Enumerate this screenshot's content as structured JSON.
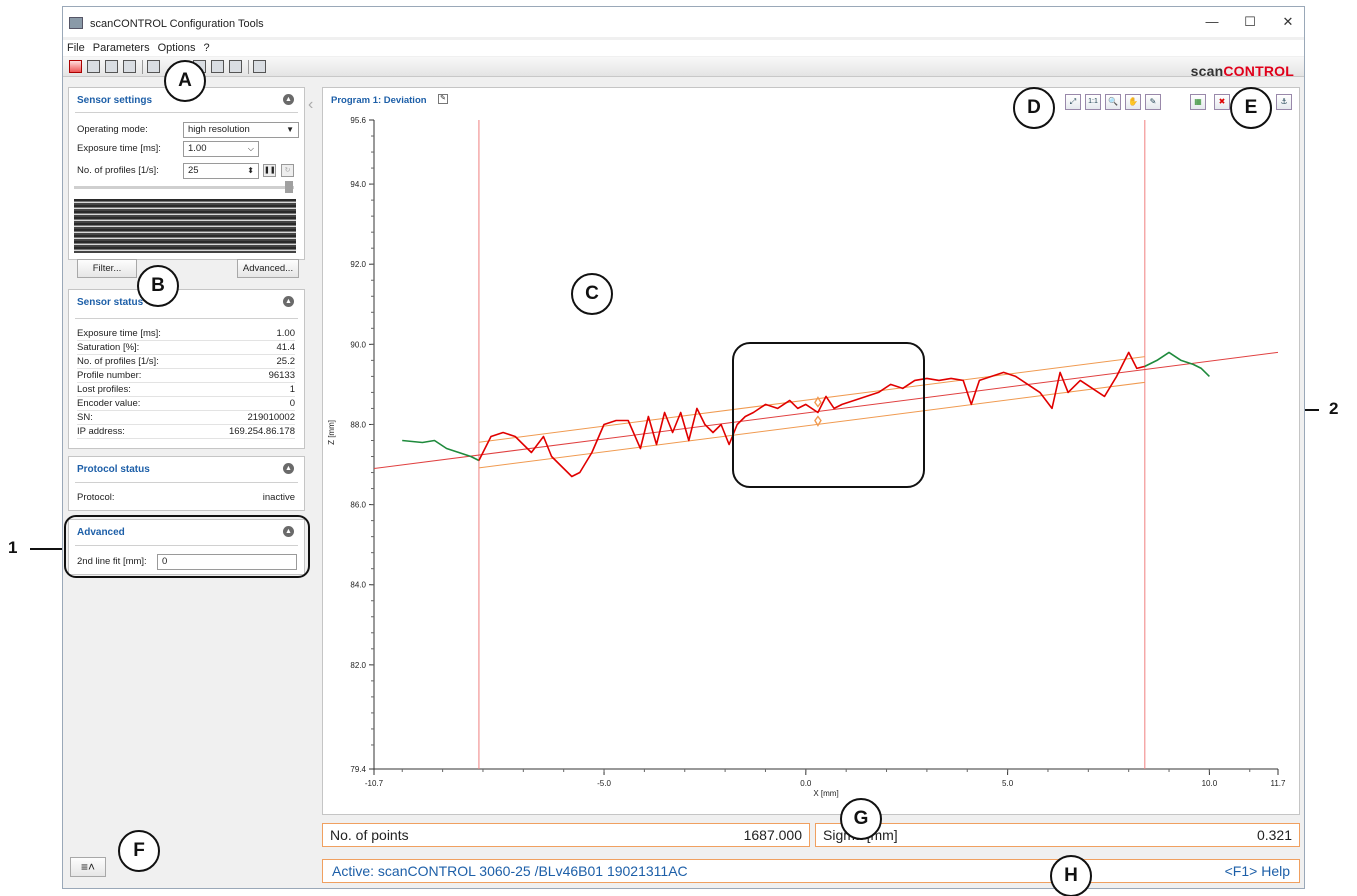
{
  "window": {
    "title": "scanCONTROL Configuration Tools",
    "controls": {
      "minimize": "—",
      "maximize": "☐",
      "close": "✕"
    }
  },
  "menu": [
    "File",
    "Parameters",
    "Options",
    "?"
  ],
  "brand": {
    "part1": "scan",
    "part2": "CONTROL",
    "accent": "#e0001a"
  },
  "sensor_settings": {
    "title": "Sensor settings",
    "operating_mode_label": "Operating mode:",
    "operating_mode_value": "high resolution",
    "exposure_label": "Exposure time [ms]:",
    "exposure_value": "1.00",
    "profiles_label": "No. of profiles [1/s]:",
    "profiles_value": "25",
    "filter_button": "Filter...",
    "advanced_button": "Advanced..."
  },
  "sensor_status": {
    "title": "Sensor status",
    "rows": [
      {
        "k": "Exposure time [ms]:",
        "v": "1.00"
      },
      {
        "k": "Saturation [%]:",
        "v": "41.4"
      },
      {
        "k": "No. of profiles [1/s]:",
        "v": "25.2"
      },
      {
        "k": "Profile number:",
        "v": "96133"
      },
      {
        "k": "Lost profiles:",
        "v": "1"
      },
      {
        "k": "Encoder value:",
        "v": "0"
      },
      {
        "k": "SN:",
        "v": "219010002"
      },
      {
        "k": "IP address:",
        "v": "169.254.86.178"
      }
    ]
  },
  "protocol_status": {
    "title": "Protocol status",
    "protocol_label": "Protocol:",
    "protocol_value": "inactive"
  },
  "advanced": {
    "title": "Advanced",
    "line_fit_label": "2nd line fit [mm]:",
    "line_fit_value": "0"
  },
  "graph": {
    "title": "Program 1: Deviation",
    "toolbar_icons": [
      "fit-icon",
      "one-to-one-icon",
      "zoom-icon",
      "pan-icon",
      "eyedropper-icon",
      "grid-icon",
      "remove-icon",
      "anchor-icon"
    ],
    "toolbar_glyphs": [
      "⤢",
      "1:1",
      "🔍",
      "✋",
      "✎",
      "▦",
      "✖",
      "⚓"
    ]
  },
  "chart_data": {
    "type": "line",
    "title": "Program 1: Deviation",
    "xlabel": "X [mm]",
    "ylabel": "Z [mm]",
    "xlim": [
      -10.7,
      11.7
    ],
    "ylim": [
      79.4,
      95.6
    ],
    "xticks": [
      "-10.7",
      "-5.0",
      "0.0",
      "5.0",
      "10.0",
      "11.7"
    ],
    "xtick_values": [
      -10.7,
      -5.0,
      0.0,
      5.0,
      10.0,
      11.7
    ],
    "yticks": [
      "95.6",
      "94.0",
      "92.0",
      "90.0",
      "88.0",
      "86.0",
      "84.0",
      "82.0",
      "79.4"
    ],
    "ytick_values": [
      95.6,
      94.0,
      92.0,
      90.0,
      88.0,
      86.0,
      84.0,
      82.0,
      79.4
    ],
    "vertical_lines": [
      -8.1,
      8.4
    ],
    "fit_line": {
      "x": [
        -10.7,
        11.7
      ],
      "y": [
        86.9,
        89.8
      ]
    },
    "tolerance_offset": 0.321,
    "series": [
      {
        "color": "#1e8a3c",
        "x": [
          -10.0,
          -9.5,
          -9.2,
          -8.9,
          -8.6,
          -8.3,
          -8.1
        ],
        "y": [
          87.6,
          87.55,
          87.6,
          87.4,
          87.3,
          87.2,
          87.1
        ]
      },
      {
        "color": "#e00000",
        "x": [
          -8.1,
          -7.8,
          -7.5,
          -7.2,
          -7.0,
          -6.8,
          -6.5,
          -6.3,
          -6.0,
          -5.8,
          -5.6,
          -5.3,
          -5.0,
          -4.7,
          -4.4,
          -4.1,
          -3.9,
          -3.7,
          -3.5,
          -3.3,
          -3.1,
          -2.9,
          -2.7,
          -2.5,
          -2.3,
          -2.1,
          -1.9,
          -1.7,
          -1.5,
          -1.3,
          -1.0,
          -0.7,
          -0.4,
          -0.2,
          0.0,
          0.3,
          0.5,
          0.7,
          0.9,
          1.2,
          1.5,
          1.8,
          2.1,
          2.4,
          2.7,
          3.0,
          3.3,
          3.6,
          3.9,
          4.1,
          4.3,
          4.6,
          4.9,
          5.2,
          5.5,
          5.8,
          6.1,
          6.3,
          6.5,
          6.8,
          7.1,
          7.4,
          7.7,
          8.0,
          8.2,
          8.4
        ],
        "y": [
          87.1,
          87.7,
          87.8,
          87.7,
          87.5,
          87.3,
          87.7,
          87.2,
          86.9,
          86.7,
          86.8,
          87.3,
          88.0,
          88.1,
          88.1,
          87.4,
          88.2,
          87.5,
          88.3,
          87.8,
          88.3,
          87.6,
          88.4,
          88.0,
          87.8,
          88.0,
          87.5,
          88.0,
          88.2,
          88.3,
          88.5,
          88.4,
          88.6,
          88.4,
          88.5,
          88.3,
          88.7,
          88.4,
          88.5,
          88.6,
          88.7,
          88.8,
          89.0,
          88.9,
          89.1,
          89.15,
          89.1,
          89.15,
          89.1,
          88.5,
          89.1,
          89.2,
          89.3,
          89.2,
          89.0,
          88.8,
          88.4,
          89.3,
          88.8,
          89.1,
          88.9,
          88.7,
          89.2,
          89.8,
          89.4,
          89.45
        ]
      },
      {
        "color": "#1e8a3c",
        "x": [
          8.4,
          8.7,
          9.0,
          9.3,
          9.6,
          9.8,
          10.0
        ],
        "y": [
          89.45,
          89.6,
          89.8,
          89.6,
          89.5,
          89.4,
          89.2
        ]
      }
    ]
  },
  "stats": [
    {
      "label": "No. of points",
      "value": "1687.000"
    },
    {
      "label": "Sigma [mm]",
      "value": "0.321"
    }
  ],
  "statusbar": {
    "active": "Active: scanCONTROL 3060-25 /BLv46B01  19021311AC",
    "help": "<F1> Help"
  },
  "callouts": [
    "A",
    "B",
    "C",
    "D",
    "E",
    "F",
    "G",
    "H"
  ],
  "side_numbers": [
    "1",
    "2"
  ]
}
